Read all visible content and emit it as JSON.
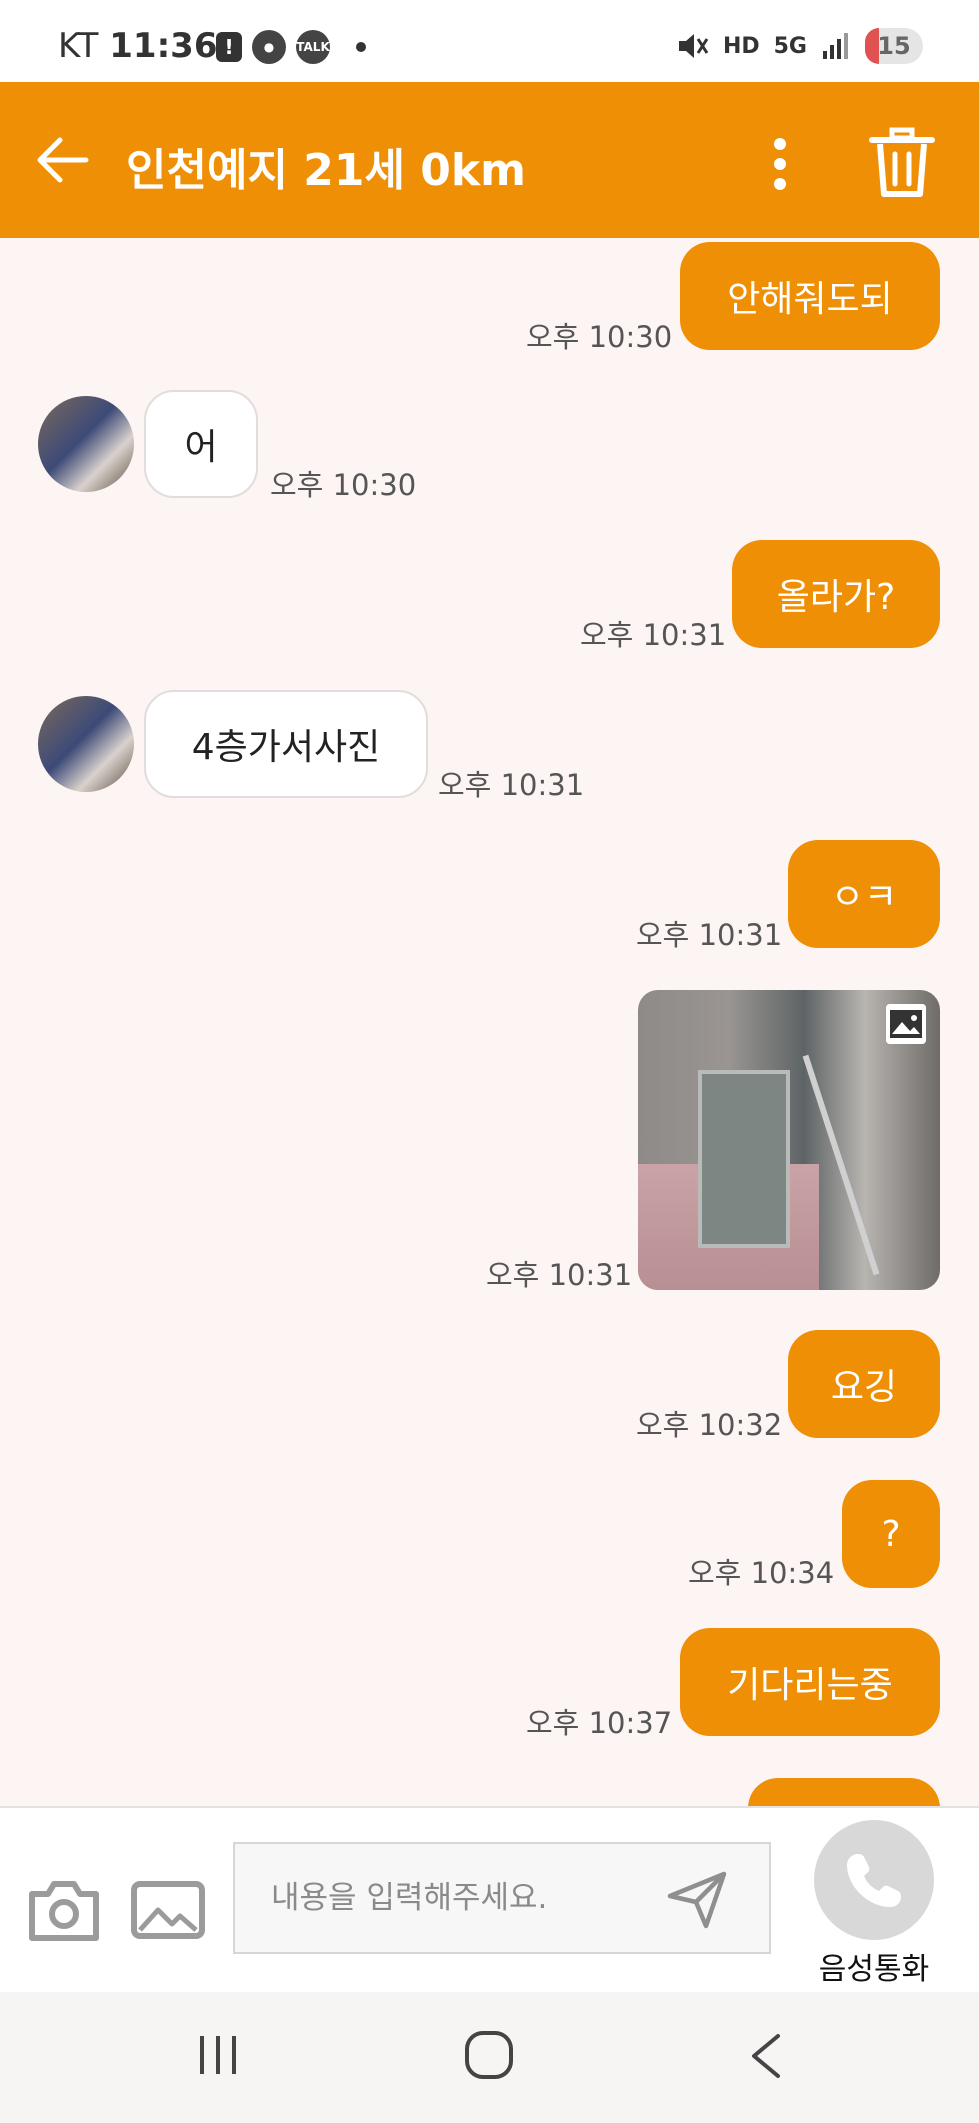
{
  "status_bar": {
    "carrier": "KT",
    "time": "11:36",
    "notif_icons": [
      "alert-icon",
      "chat-app-icon",
      "kakaotalk-icon"
    ],
    "network": "5G",
    "hd": "HD",
    "battery": "15"
  },
  "header": {
    "title": "인천예지 21세 0km"
  },
  "messages": [
    {
      "side": "me",
      "text": "안해줘도되",
      "time": "오후 10:30"
    },
    {
      "side": "them",
      "text": "어",
      "time": "오후 10:30"
    },
    {
      "side": "me",
      "text": "올라가?",
      "time": "오후 10:31"
    },
    {
      "side": "them",
      "text": "4층가서사진",
      "time": "오후 10:31"
    },
    {
      "side": "me",
      "text": "ㅇㅋ",
      "time": "오후 10:31"
    },
    {
      "side": "me",
      "type": "image",
      "time": "오후 10:31"
    },
    {
      "side": "me",
      "text": "요깅",
      "time": "오후 10:32"
    },
    {
      "side": "me",
      "text": "?",
      "time": "오후 10:34"
    },
    {
      "side": "me",
      "text": "기다리는중",
      "time": "오후 10:37"
    }
  ],
  "input": {
    "placeholder": "내용을 입력해주세요."
  },
  "call": {
    "label": "음성통화"
  },
  "colors": {
    "accent": "#ef8f06",
    "chat_bg": "#fdf4f4"
  }
}
